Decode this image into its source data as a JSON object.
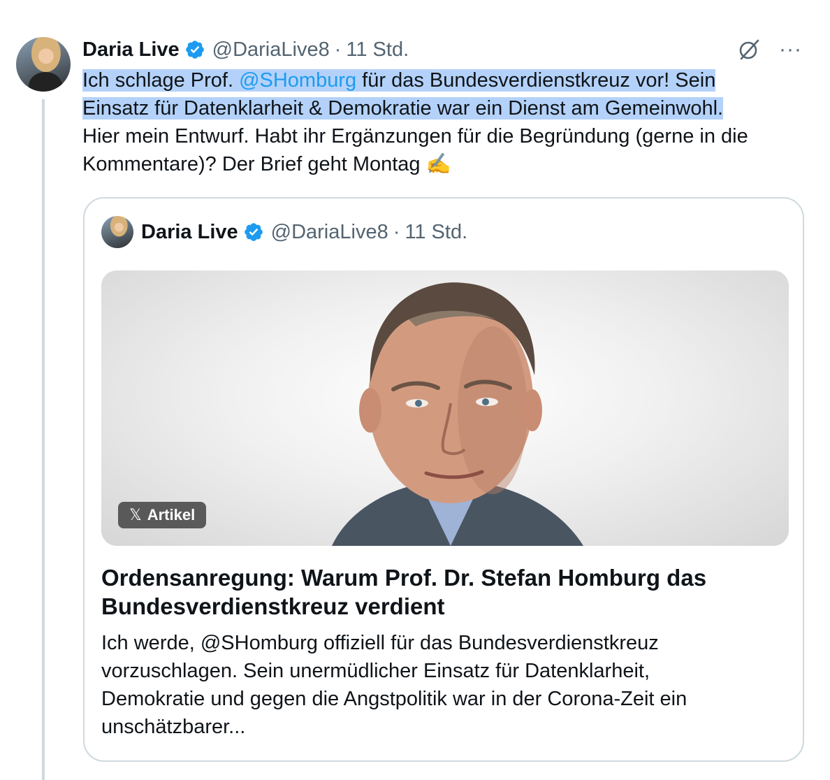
{
  "tweet": {
    "author_name": "Daria Live",
    "handle": "@DariaLive8",
    "separator": "·",
    "time": "11 Std.",
    "more_label": "···",
    "text": {
      "line1_pre": "Ich schlage Prof. ",
      "mention": "@SHomburg",
      "line1_post": " für das Bundesverdienstkreuz vor! Sein",
      "line2": "Einsatz für Datenklarheit & Demokratie war ein Dienst am Gemeinwohl.",
      "line3": "Hier mein Entwurf. Habt ihr Ergänzungen für die Begründung (gerne in die",
      "line4": "Kommentare)? Der Brief geht Montag ",
      "emoji": "✍️"
    }
  },
  "quote": {
    "author_name": "Daria Live",
    "handle": "@DariaLive8",
    "separator": "·",
    "time": "11 Std.",
    "badge_icon": "𝕏",
    "badge_label": "Artikel",
    "article_title": "Ordensanregung: Warum Prof. Dr. Stefan Homburg das Bundesverdienstkreuz verdient",
    "article_desc": "Ich werde, @SHomburg offiziell für das Bundesverdienstkreuz vorzuschlagen. Sein unermüdlicher Einsatz für Datenklarheit, Demokratie und gegen die Angstpolitik war in der Corona-Zeit ein unschätzbarer..."
  },
  "icons": {
    "verified": "verified-badge-icon",
    "grok": "grok-icon",
    "more": "more-icon",
    "x_logo": "x-logo-icon"
  },
  "colors": {
    "accent": "#1d9bf0",
    "highlight": "#b4d2f9",
    "muted": "#536471",
    "border": "#cfd9de"
  }
}
